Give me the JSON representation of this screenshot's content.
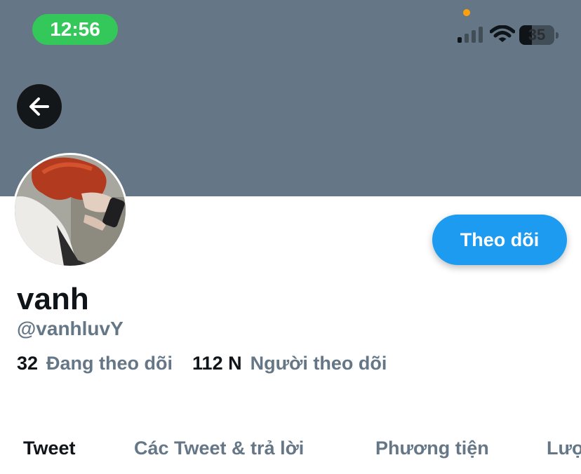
{
  "status_bar": {
    "time": "12:56",
    "battery_level": "35",
    "icons": [
      "cellular-signal-icon",
      "wifi-icon",
      "battery-icon"
    ],
    "time_pill_color": "#34c759",
    "mic_dot_color": "#ff9f0a"
  },
  "header": {
    "banner_color": "#657786",
    "back_icon": "arrow-left-icon"
  },
  "profile": {
    "display_name": "vanh",
    "handle": "@vanhluvY",
    "follow_label": "Theo dõi",
    "following_count": "32",
    "following_label": "Đang theo dõi",
    "followers_count": "112 N",
    "followers_label": "Người theo dõi"
  },
  "tabs": [
    {
      "label": "Tweet",
      "active": true
    },
    {
      "label": "Các Tweet & trả lời",
      "active": false
    },
    {
      "label": "Phương tiện",
      "active": false
    },
    {
      "label": "Lượt thích",
      "active": false
    }
  ],
  "colors": {
    "accent": "#1d9bf0",
    "text_primary": "#0f1419",
    "text_secondary": "#657786"
  }
}
